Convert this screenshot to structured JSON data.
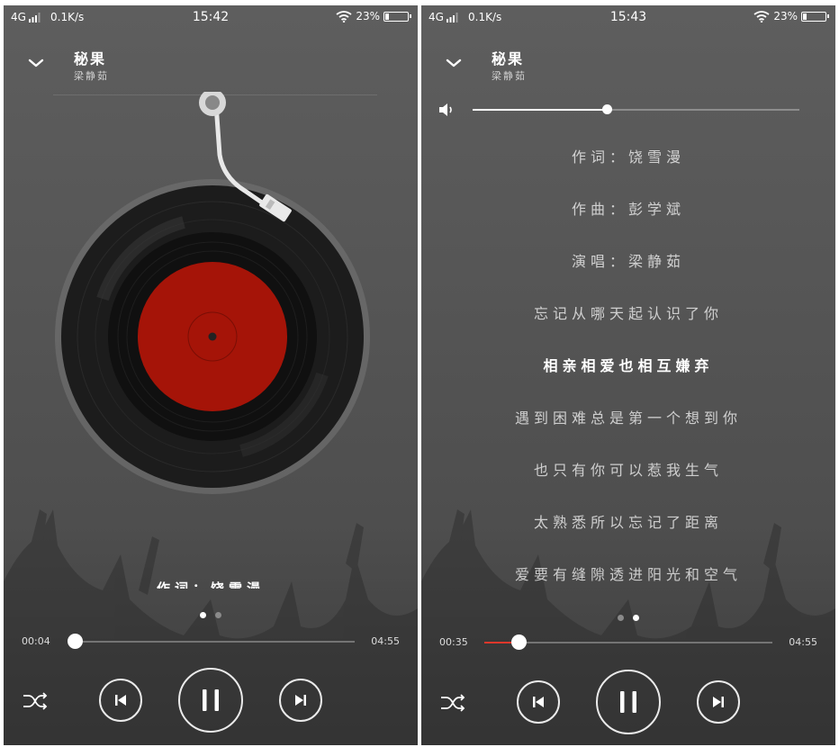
{
  "screens": [
    {
      "status": {
        "network": "4G",
        "speed": "0.1K/s",
        "time": "15:42",
        "battery": "23%",
        "battery_level": 0.23
      },
      "song": {
        "title": "秘果",
        "artist": "梁静茹"
      },
      "lyric_peek": "作词：饶雪漫",
      "pager": {
        "count": 2,
        "active": 0
      },
      "progress": {
        "current": "00:04",
        "total": "04:55",
        "fraction": 0.014
      },
      "icons": [
        "chevron-down-icon",
        "tonearm-icon",
        "vinyl-record-icon",
        "shuffle-icon",
        "previous-icon",
        "pause-icon",
        "next-icon"
      ],
      "colors": {
        "record_label": "#a51408",
        "record_vinyl": "#1a1a1a"
      }
    },
    {
      "status": {
        "network": "4G",
        "speed": "0.1K/s",
        "time": "15:43",
        "battery": "23%",
        "battery_level": 0.23
      },
      "song": {
        "title": "秘果",
        "artist": "梁静茹"
      },
      "volume": {
        "level": 0.41
      },
      "lyrics": [
        "作词：饶雪漫",
        "作曲：彭学斌",
        "演唱：梁静茹",
        "忘记从哪天起认识了你",
        "相亲相爱也相互嫌弃",
        "遇到困难总是第一个想到你",
        "也只有你可以惹我生气",
        "太熟悉所以忘记了距离",
        "爱要有缝隙透进阳光和空气"
      ],
      "active_lyric": 4,
      "pager": {
        "count": 2,
        "active": 1
      },
      "progress": {
        "current": "00:35",
        "total": "04:55",
        "fraction": 0.119
      },
      "icons": [
        "chevron-down-icon",
        "volume-icon",
        "shuffle-icon",
        "previous-icon",
        "pause-icon",
        "next-icon"
      ],
      "colors": {
        "progress_played": "#e0372b"
      }
    }
  ]
}
